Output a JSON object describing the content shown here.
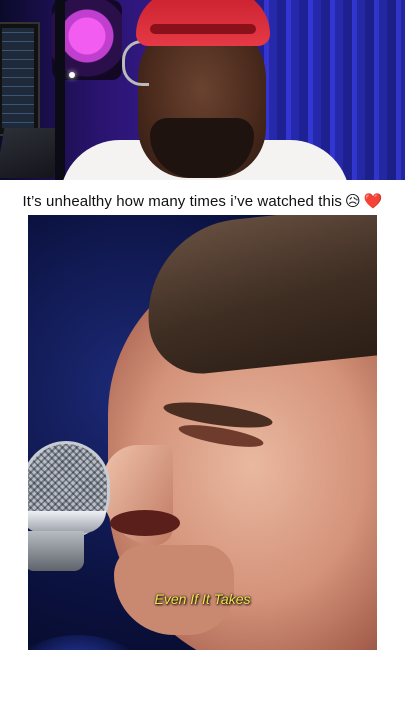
{
  "caption": {
    "text": "It’s unhealthy how many times i’ve watched this",
    "emoji_face": "😥",
    "emoji_heart": "❤️"
  },
  "main_video": {
    "subtitle": "Even If It Takes"
  },
  "colors": {
    "subtitle": "#f2e24a",
    "background": "#ffffff",
    "heart": "#e0243a"
  }
}
